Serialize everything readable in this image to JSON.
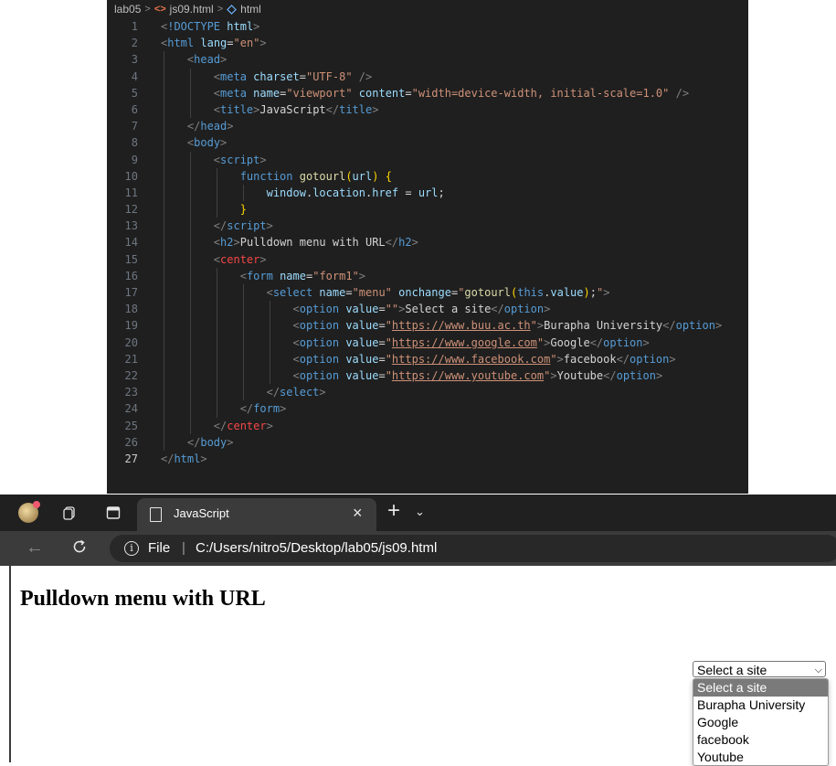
{
  "editor": {
    "breadcrumb": [
      "lab05",
      "js09.html",
      "html"
    ],
    "current_line": 27
  },
  "browser": {
    "tab_title": "JavaScript",
    "address_prefix": "File",
    "address_url": "C:/Users/nitro5/Desktop/lab05/js09.html",
    "heading": "Pulldown menu with URL",
    "select_value": "Select a site",
    "options": [
      "Select a site",
      "Burapha University",
      "Google",
      "facebook",
      "Youtube"
    ],
    "selected_index": 0
  },
  "colors": {
    "editor_bg": "#1f1f1f",
    "tag": "#569cd6",
    "attribute": "#9cdcfe",
    "string": "#ce9178",
    "function": "#dcdcaa",
    "deprecated_tag": "#f44747",
    "browser_chrome": "#202020",
    "option_highlight": "#7a7a7a"
  }
}
